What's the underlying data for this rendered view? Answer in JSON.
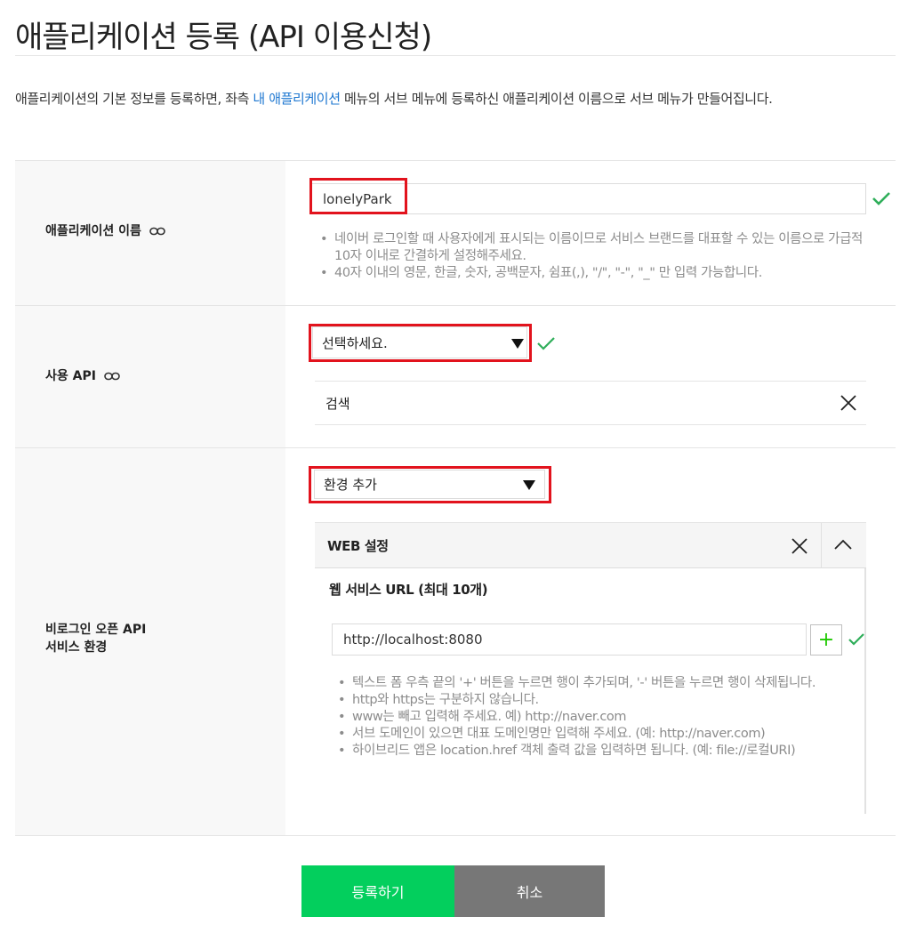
{
  "page": {
    "title": "애플리케이션 등록 (API 이용신청)",
    "intro_before": "애플리케이션의 기본 정보를 등록하면, 좌측 ",
    "intro_link": "내 애플리케이션",
    "intro_after": " 메뉴의 서브 메뉴에 등록하신 애플리케이션 이름으로 서브 메뉴가 만들어집니다."
  },
  "app_name": {
    "label": "애플리케이션 이름",
    "value": "lonelyPark",
    "notes": [
      "네이버 로그인할 때 사용자에게 표시되는 이름이므로 서비스 브랜드를 대표할 수 있는 이름으로 가급적 10자 이내로 간결하게 설정해주세요.",
      "40자 이내의 영문, 한글, 숫자, 공백문자, 쉼표(,), \"/\", \"-\", \"_\" 만 입력 가능합니다."
    ]
  },
  "api": {
    "label": "사용 API",
    "select_value": "선택하세요.",
    "selected_item": "검색"
  },
  "env": {
    "label_line1": "비로그인 오픈 API",
    "label_line2": "서비스 환경",
    "select_value": "환경 추가",
    "panel_title": "WEB 설정",
    "url_label": "웹 서비스 URL (최대 10개)",
    "url_value": "http://localhost:8080",
    "plus_symbol": "+",
    "notes": [
      "텍스트 폼 우측 끝의 '+' 버튼을 누르면 행이 추가되며, '-' 버튼을 누르면 행이 삭제됩니다.",
      "http와 https는 구분하지 않습니다.",
      "www는 빼고 입력해 주세요. 예) http://naver.com",
      "서브 도메인이 있으면 대표 도메인명만 입력해 주세요. (예: http://naver.com)",
      "하이브리드 앱은 location.href 객체 출력 값을 입력하면 됩니다. (예: file://로컬URI)"
    ]
  },
  "buttons": {
    "submit": "등록하기",
    "cancel": "취소"
  },
  "colors": {
    "accent_green": "#03cf5d",
    "check_green": "#2fae5a",
    "highlight_red": "#e2131d",
    "link_blue": "#1f78d1"
  },
  "icons": [
    "link-icon",
    "check-icon",
    "caret-down-icon",
    "close-icon",
    "chevron-up-icon",
    "plus-icon"
  ]
}
